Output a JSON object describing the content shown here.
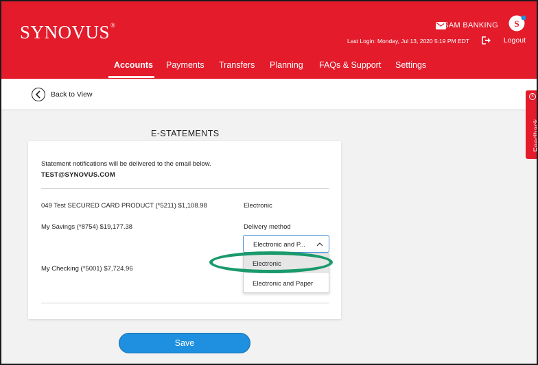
{
  "header": {
    "logo_text": "SYNOVUS",
    "logo_mark": "®",
    "user_name": "SAM BANKING",
    "last_login": "Last Login: Monday, Jul 13, 2020 5:19 PM EDT",
    "logout_label": "Logout",
    "brand_color": "#e31b2b"
  },
  "nav": {
    "items": [
      {
        "label": "Accounts",
        "active": true
      },
      {
        "label": "Payments",
        "active": false
      },
      {
        "label": "Transfers",
        "active": false
      },
      {
        "label": "Planning",
        "active": false
      },
      {
        "label": "FAQs & Support",
        "active": false
      },
      {
        "label": "Settings",
        "active": false
      }
    ]
  },
  "back": {
    "label": "Back to View"
  },
  "feedback": {
    "label": "Feedback",
    "close": "×"
  },
  "estatements": {
    "title": "E-STATEMENTS",
    "notice": "Statement notifications will be delivered to the email below.",
    "email": "TEST@SYNOVUS.COM",
    "accounts": [
      {
        "name": "049 Test SECURED CARD PRODUCT (*5211) $1,108.98",
        "status": "Electronic"
      },
      {
        "name": "My Savings (*8754) $19,177.38"
      },
      {
        "name": "My Checking (*5001) $7,724.96"
      }
    ],
    "delivery_method_label": "Delivery method",
    "select_value": "Electronic and P...",
    "options": [
      "Electronic",
      "Electronic and Paper"
    ],
    "save_label": "Save"
  },
  "colors": {
    "primary_button": "#1f8fe0",
    "highlight_ring": "#1a9a6c"
  },
  "icons": {
    "mail": "mail-icon",
    "logout": "logout-icon",
    "back": "chevron-left-icon",
    "dropdown": "chevron-up-icon"
  }
}
